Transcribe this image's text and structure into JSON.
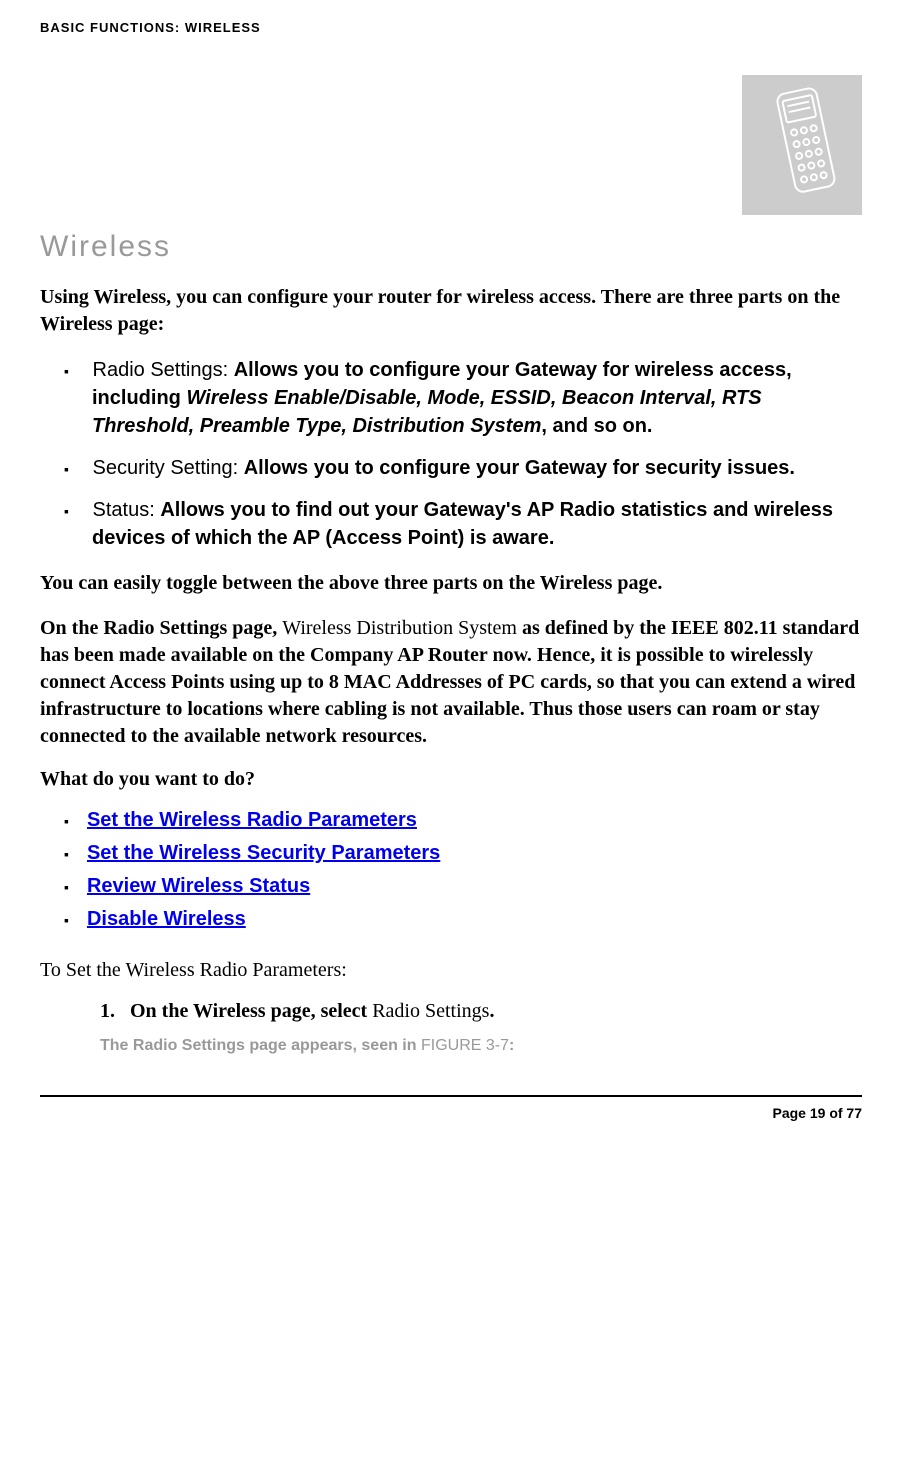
{
  "header": {
    "running_title": "BASIC FUNCTIONS: WIRELESS"
  },
  "section": {
    "title": "Wireless",
    "intro": "Using Wireless, you can configure your router for wireless access. There are three parts on the Wireless page:"
  },
  "bullets": [
    {
      "label": "Radio Settings: ",
      "text_before_italic": "Allows you to configure your Gateway for wireless access, including ",
      "italic_parts": "Wireless Enable/Disable, Mode, ESSID, Beacon Interval, RTS Threshold, Preamble Type, Distribution System",
      "text_after_italic": ", and so on."
    },
    {
      "label": "Security Setting: ",
      "text": "Allows you to configure your Gateway for security issues."
    },
    {
      "label": "Status: ",
      "text": "Allows you to find out your Gateway's AP Radio statistics and wireless devices of which the AP (Access Point) is aware."
    }
  ],
  "toggle_text": "You can easily toggle between the above three parts on the Wireless page.",
  "wds": {
    "prefix": "On the Radio Settings page, ",
    "normal": "Wireless Distribution System",
    "suffix": " as defined by the IEEE 802.11 standard has been made available on the Company AP Router now. Hence, it is possible to wirelessly connect Access Points using up to 8 MAC Addresses of PC cards, so that you can extend a wired infrastructure to locations where cabling is not available. Thus those users can roam or stay connected to the available network resources."
  },
  "question": "What do you want to do?",
  "links": [
    "Set the Wireless Radio Parameters",
    "Set the Wireless Security Parameters",
    "Review Wireless Status",
    "Disable Wireless"
  ],
  "to_set": "To Set the Wireless Radio Parameters:",
  "step1": {
    "num": "1.",
    "bold": "On the Wireless page, select ",
    "nonbold": "Radio Settings",
    "trail": "."
  },
  "figure": {
    "text_prefix": "The Radio Settings page appears, seen in ",
    "fig": "FIGURE 3-7",
    "text_suffix": ":"
  },
  "footer": {
    "page": "Page 19 of 77"
  }
}
